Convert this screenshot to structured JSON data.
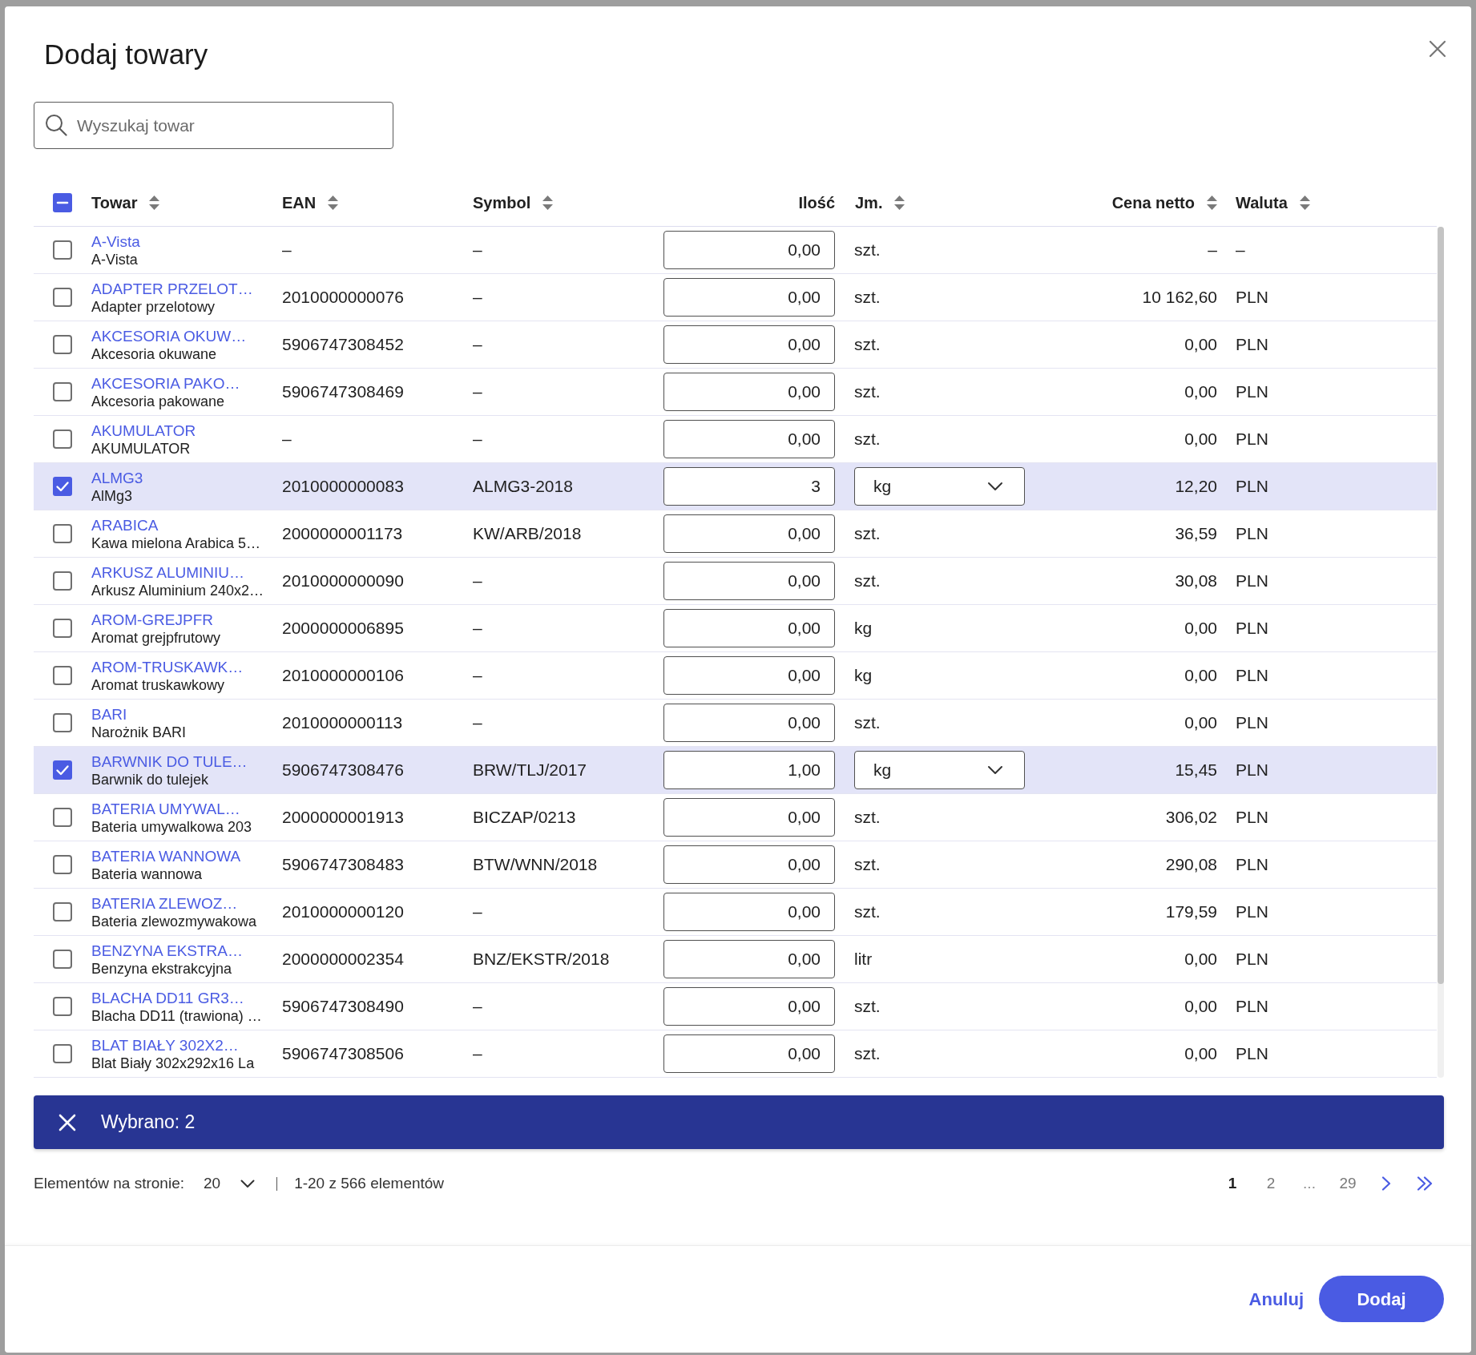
{
  "dialog": {
    "title": "Dodaj towary"
  },
  "search": {
    "placeholder": "Wyszukaj towar"
  },
  "table": {
    "select_all": {
      "indeterminate": true
    },
    "columns": [
      {
        "label": "Towar",
        "sortable": true
      },
      {
        "label": "EAN",
        "sortable": true
      },
      {
        "label": "Symbol",
        "sortable": true
      },
      {
        "label": "Ilość",
        "sortable": false
      },
      {
        "label": "Jm.",
        "sortable": true
      },
      {
        "label": "Cena netto",
        "sortable": true
      },
      {
        "label": "Waluta",
        "sortable": true
      }
    ],
    "rows": [
      {
        "code": "A-Vista",
        "name": "A-Vista",
        "ean": "–",
        "symbol": "–",
        "quantity": "0,00",
        "unit": "szt.",
        "price": "–",
        "currency": "–",
        "selected": false
      },
      {
        "code": "ADAPTER PRZELOT…",
        "name": "Adapter przelotowy",
        "ean": "2010000000076",
        "symbol": "–",
        "quantity": "0,00",
        "unit": "szt.",
        "price": "10 162,60",
        "currency": "PLN",
        "selected": false
      },
      {
        "code": "AKCESORIA OKUW…",
        "name": "Akcesoria okuwane",
        "ean": "5906747308452",
        "symbol": "–",
        "quantity": "0,00",
        "unit": "szt.",
        "price": "0,00",
        "currency": "PLN",
        "selected": false
      },
      {
        "code": "AKCESORIA PAKO…",
        "name": "Akcesoria pakowane",
        "ean": "5906747308469",
        "symbol": "–",
        "quantity": "0,00",
        "unit": "szt.",
        "price": "0,00",
        "currency": "PLN",
        "selected": false
      },
      {
        "code": "AKUMULATOR",
        "name": "AKUMULATOR",
        "ean": "–",
        "symbol": "–",
        "quantity": "0,00",
        "unit": "szt.",
        "price": "0,00",
        "currency": "PLN",
        "selected": false
      },
      {
        "code": "ALMG3",
        "name": "AlMg3",
        "ean": "2010000000083",
        "symbol": "ALMG3-2018",
        "quantity": "3",
        "unit": "kg",
        "price": "12,20",
        "currency": "PLN",
        "selected": true
      },
      {
        "code": "ARABICA",
        "name": "Kawa mielona Arabica 5…",
        "ean": "2000000001173",
        "symbol": "KW/ARB/2018",
        "quantity": "0,00",
        "unit": "szt.",
        "price": "36,59",
        "currency": "PLN",
        "selected": false
      },
      {
        "code": "ARKUSZ ALUMINIU…",
        "name": "Arkusz Aluminium 240x2…",
        "ean": "2010000000090",
        "symbol": "–",
        "quantity": "0,00",
        "unit": "szt.",
        "price": "30,08",
        "currency": "PLN",
        "selected": false
      },
      {
        "code": "AROM-GREJPFR",
        "name": "Aromat grejpfrutowy",
        "ean": "2000000006895",
        "symbol": "–",
        "quantity": "0,00",
        "unit": "kg",
        "price": "0,00",
        "currency": "PLN",
        "selected": false
      },
      {
        "code": "AROM-TRUSKAWK…",
        "name": "Aromat truskawkowy",
        "ean": "2010000000106",
        "symbol": "–",
        "quantity": "0,00",
        "unit": "kg",
        "price": "0,00",
        "currency": "PLN",
        "selected": false
      },
      {
        "code": "BARI",
        "name": "Narożnik BARI",
        "ean": "2010000000113",
        "symbol": "–",
        "quantity": "0,00",
        "unit": "szt.",
        "price": "0,00",
        "currency": "PLN",
        "selected": false
      },
      {
        "code": "BARWNIK DO TULE…",
        "name": "Barwnik do tulejek",
        "ean": "5906747308476",
        "symbol": "BRW/TLJ/2017",
        "quantity": "1,00",
        "unit": "kg",
        "price": "15,45",
        "currency": "PLN",
        "selected": true
      },
      {
        "code": "BATERIA UMYWAL…",
        "name": "Bateria umywalkowa 203",
        "ean": "2000000001913",
        "symbol": "BICZAP/0213",
        "quantity": "0,00",
        "unit": "szt.",
        "price": "306,02",
        "currency": "PLN",
        "selected": false
      },
      {
        "code": "BATERIA WANNOWA",
        "name": "Bateria wannowa",
        "ean": "5906747308483",
        "symbol": "BTW/WNN/2018",
        "quantity": "0,00",
        "unit": "szt.",
        "price": "290,08",
        "currency": "PLN",
        "selected": false
      },
      {
        "code": "BATERIA ZLEWOZ…",
        "name": "Bateria zlewozmywakowa",
        "ean": "2010000000120",
        "symbol": "–",
        "quantity": "0,00",
        "unit": "szt.",
        "price": "179,59",
        "currency": "PLN",
        "selected": false
      },
      {
        "code": "BENZYNA EKSTRA…",
        "name": "Benzyna ekstrakcyjna",
        "ean": "2000000002354",
        "symbol": "BNZ/EKSTR/2018",
        "quantity": "0,00",
        "unit": "litr",
        "price": "0,00",
        "currency": "PLN",
        "selected": false
      },
      {
        "code": "BLACHA DD11 GR3…",
        "name": "Blacha DD11 (trawiona) …",
        "ean": "5906747308490",
        "symbol": "–",
        "quantity": "0,00",
        "unit": "szt.",
        "price": "0,00",
        "currency": "PLN",
        "selected": false
      },
      {
        "code": "BLAT BIAŁY 302X2…",
        "name": "Blat Biały 302x292x16 La",
        "ean": "5906747308506",
        "symbol": "–",
        "quantity": "0,00",
        "unit": "szt.",
        "price": "0,00",
        "currency": "PLN",
        "selected": false
      }
    ]
  },
  "selection_bar": {
    "label": "Wybrano: 2"
  },
  "pagination": {
    "page_size_label": "Elementów na stronie:",
    "page_size": "20",
    "range": "1-20 z 566 elementów",
    "pages": [
      {
        "label": "1",
        "kind": "page",
        "selected": true
      },
      {
        "label": "2",
        "kind": "page",
        "selected": false
      },
      {
        "label": "...",
        "kind": "ellipsis",
        "selected": false
      },
      {
        "label": "29",
        "kind": "page",
        "selected": false
      }
    ]
  },
  "footer": {
    "buttons": [
      {
        "label": "Anuluj",
        "kind": "link"
      },
      {
        "label": "Dodaj",
        "kind": "primary"
      }
    ]
  }
}
